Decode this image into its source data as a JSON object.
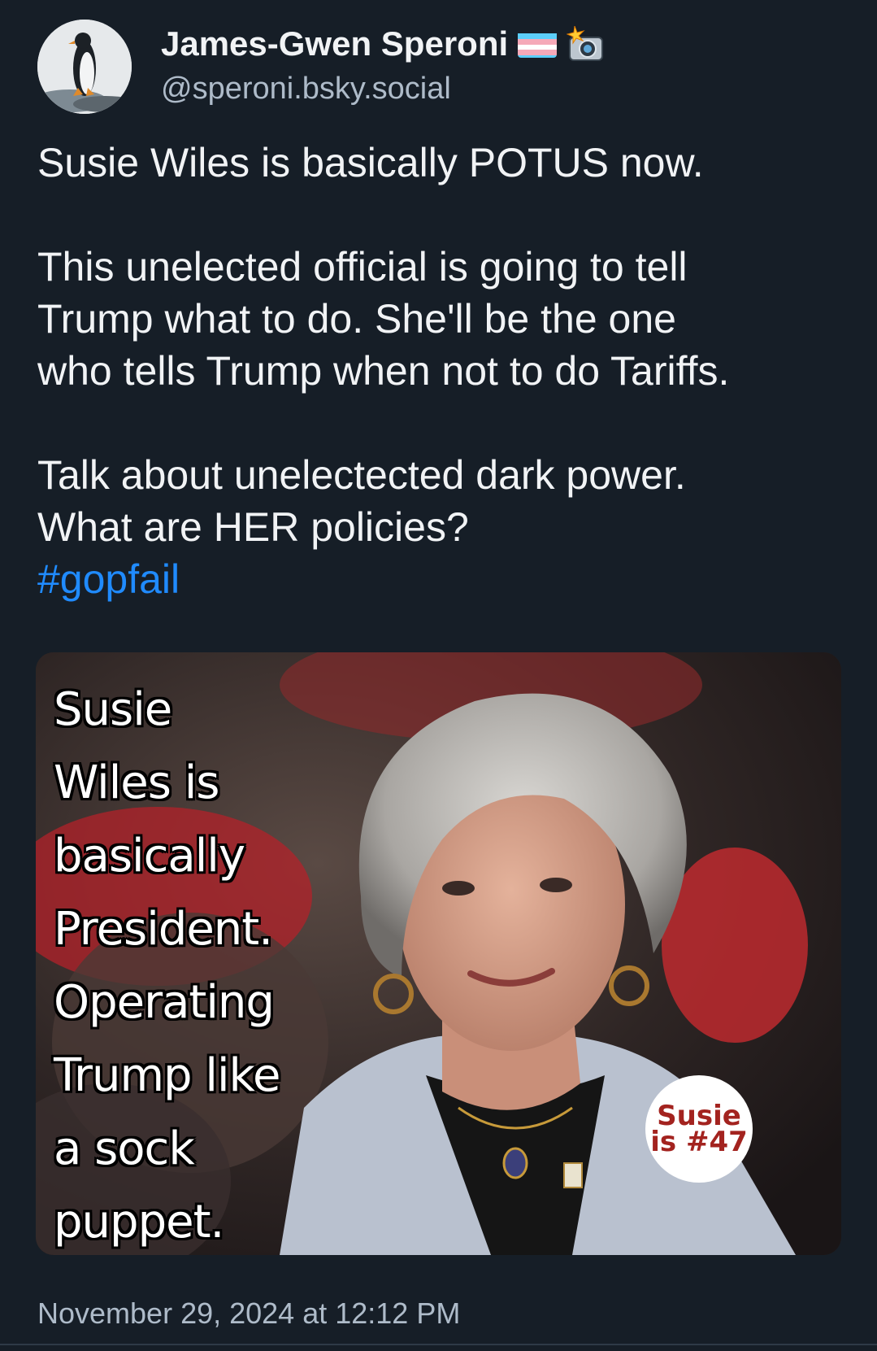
{
  "author": {
    "display_name": "James-Gwen Speroni",
    "handle": "@speroni.bsky.social",
    "avatar_icon": "penguin-avatar",
    "name_icons": [
      "transgender-flag-icon",
      "camera-flash-icon"
    ]
  },
  "post": {
    "paragraph_1": "Susie Wiles is basically POTUS now.",
    "paragraph_2_line_1": "This unelected official is going to tell",
    "paragraph_2_line_2": "Trump what to do. She'll be the one",
    "paragraph_2_line_3": "who tells Trump when not to do Tariffs.",
    "paragraph_3_line_1": "Talk about unelectected dark power.",
    "paragraph_3_line_2": "What are HER policies?",
    "hashtag": "#gopfail",
    "timestamp": "November 29, 2024 at 12:12 PM"
  },
  "image": {
    "caption_lines": [
      "Susie",
      "Wiles is",
      "basically",
      "President.",
      "Operating",
      "Trump like",
      "a sock",
      "puppet."
    ],
    "badge_line_1": "Susie",
    "badge_line_2": "is #47"
  },
  "colors": {
    "background": "#161e27",
    "text": "#f1f3f5",
    "muted": "#aebbc9",
    "link": "#208bfe",
    "badge_text": "#a3231f"
  }
}
